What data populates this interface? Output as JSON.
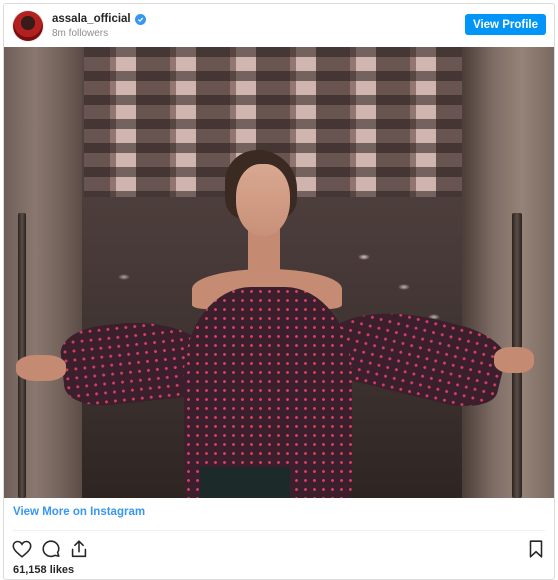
{
  "header": {
    "username": "assala_official",
    "followers": "8m followers",
    "view_profile_label": "View Profile"
  },
  "icons": {
    "verified": "verified-badge-icon",
    "like": "heart-icon",
    "comment": "comment-icon",
    "share": "share-icon",
    "save": "bookmark-icon"
  },
  "footer": {
    "view_more_label": "View More on Instagram",
    "likes": "61,158 likes"
  },
  "colors": {
    "accent": "#3897f0",
    "button": "#0095f6"
  }
}
